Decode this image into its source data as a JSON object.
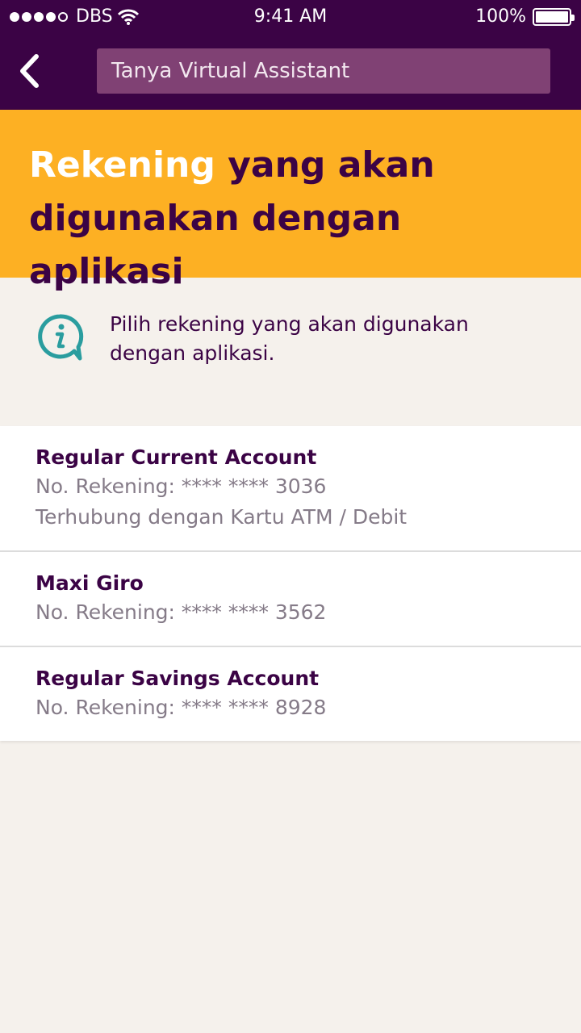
{
  "status_bar": {
    "carrier": "DBS",
    "time": "9:41 AM",
    "battery": "100%"
  },
  "header": {
    "search_text": "Tanya Virtual Assistant",
    "back_icon": "chevron-left-icon"
  },
  "banner": {
    "title_highlight": "Rekening",
    "title_rest": " yang akan digunakan dengan aplikasi"
  },
  "info": {
    "icon": "info-bubble-icon",
    "text": "Pilih rekening yang akan digunakan dengan aplikasi."
  },
  "accounts": [
    {
      "name": "Regular Current Account",
      "number": "No. Rekening: **** **** 3036",
      "note": "Terhubung dengan Kartu ATM / Debit"
    },
    {
      "name": "Maxi Giro",
      "number": "No. Rekening: **** **** 3562"
    },
    {
      "name": "Regular Savings Account",
      "number": "No. Rekening: **** **** 8928"
    }
  ],
  "colors": {
    "brand_purple": "#3b0345",
    "banner_yellow": "#fdb023",
    "search_bg": "#804174",
    "info_teal": "#2a9d9f",
    "background": "#f5f1ec"
  }
}
